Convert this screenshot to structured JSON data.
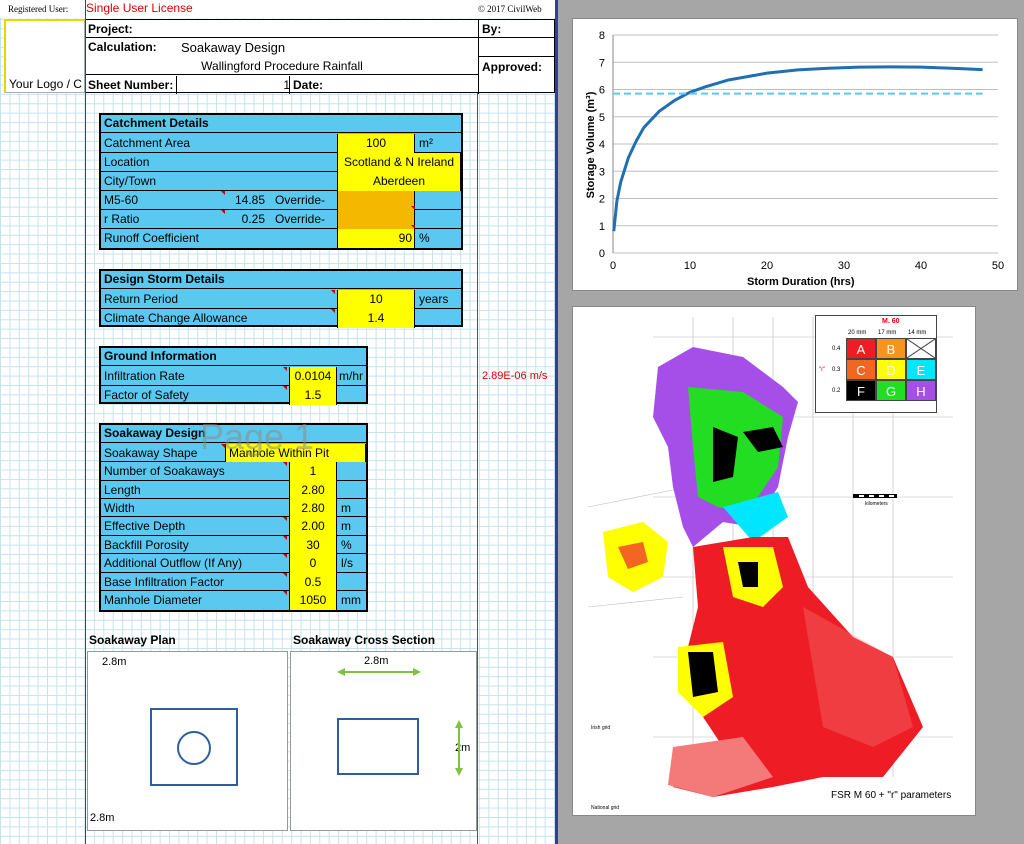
{
  "topbar": {
    "registered_label": "Registered User:",
    "license": "Single User License",
    "copyright": "© 2017 CivilWeb"
  },
  "logo": {
    "text": "Your Logo / C"
  },
  "header": {
    "project_label": "Project:",
    "by_label": "By:",
    "calculation_label": "Calculation:",
    "calculation_value": "Soakaway Design",
    "subtitle": "Wallingford Procedure Rainfall",
    "approved_label": "Approved:",
    "sheet_label": "Sheet Number:",
    "sheet_value": "1",
    "date_label": "Date:"
  },
  "watermark": "Page 1",
  "catchment": {
    "title": "Catchment Details",
    "area_label": "Catchment Area",
    "area_value": "100",
    "area_unit": "m²",
    "location_label": "Location",
    "location_value": "Scotland & N Ireland",
    "city_label": "City/Town",
    "city_value": "Aberdeen",
    "m560_label": "M5-60",
    "m560_value": "14.85",
    "override1": "Override-",
    "r_label": "r Ratio",
    "r_value": "0.25",
    "override2": "Override-",
    "runoff_label": "Runoff Coefficient",
    "runoff_value": "90",
    "runoff_unit": "%"
  },
  "storm": {
    "title": "Design Storm Details",
    "return_label": "Return Period",
    "return_value": "10",
    "return_unit": "years",
    "climate_label": "Climate Change Allowance",
    "climate_value": "1.4"
  },
  "ground": {
    "title": "Ground Information",
    "infil_label": "Infiltration Rate",
    "infil_value": "0.0104",
    "infil_unit": "m/hr",
    "infil_converted": "2.89E-06 m/s",
    "fos_label": "Factor of Safety",
    "fos_value": "1.5"
  },
  "soakaway": {
    "title": "Soakaway Design",
    "shape_label": "Soakaway Shape",
    "shape_value": "Manhole Within Pit",
    "number_label": "Number of Soakaways",
    "number_value": "1",
    "length_label": "Length",
    "length_value": "2.80",
    "width_label": "Width",
    "width_value": "2.80",
    "width_unit": "m",
    "depth_label": "Effective Depth",
    "depth_value": "2.00",
    "depth_unit": "m",
    "porosity_label": "Backfill Porosity",
    "porosity_value": "30",
    "porosity_unit": "%",
    "outflow_label": "Additional Outflow (If Any)",
    "outflow_value": "0",
    "outflow_unit": "l/s",
    "base_label": "Base Infiltration Factor",
    "base_value": "0.5",
    "manhole_label": "Manhole Diameter",
    "manhole_value": "1050",
    "manhole_unit": "mm"
  },
  "plan": {
    "title": "Soakaway Plan",
    "top_dim": "2.8m",
    "bottom_dim": "2.8m"
  },
  "section": {
    "title": "Soakaway Cross Section",
    "width_dim": "2.8m",
    "height_dim": "2m"
  },
  "chart_data": {
    "type": "line",
    "title": "",
    "xlabel": "Storm Duration (hrs)",
    "ylabel": "Storage Volume (m³)",
    "xlim": [
      0,
      50
    ],
    "ylim": [
      0,
      8
    ],
    "xticks": [
      0,
      10,
      20,
      30,
      40,
      50
    ],
    "yticks": [
      0,
      1,
      2,
      3,
      4,
      5,
      6,
      7,
      8
    ],
    "grid": true,
    "series": [
      {
        "color": "#1f6fb2",
        "style": "solid",
        "x": [
          0.1,
          0.5,
          1,
          2,
          3,
          4,
          6,
          8,
          10,
          12,
          15,
          18,
          20,
          24,
          28,
          32,
          36,
          40,
          44,
          48
        ],
        "y": [
          0.8,
          1.9,
          2.6,
          3.5,
          4.1,
          4.6,
          5.2,
          5.6,
          5.9,
          6.1,
          6.35,
          6.5,
          6.6,
          6.72,
          6.78,
          6.82,
          6.83,
          6.82,
          6.78,
          6.73
        ]
      },
      {
        "color": "#5bc8ef",
        "style": "dashed",
        "x": [
          0,
          48
        ],
        "y": [
          5.85,
          5.85
        ]
      }
    ]
  },
  "map": {
    "legend_title": "M. 60",
    "legend_cols": [
      "20 mm",
      "17 mm",
      "14 mm"
    ],
    "legend_rows": [
      "0.4",
      "0.3",
      "0.2"
    ],
    "legend_r_label": "\"r\"",
    "legend_cells": [
      "A",
      "B",
      "",
      "C",
      "D",
      "E",
      "F",
      "G",
      "H"
    ],
    "legend_colors": [
      "#ee1c24",
      "#f7941d",
      "#ffffff",
      "#f26522",
      "#ffff00",
      "#00e6ff",
      "#000000",
      "#22dd22",
      "#a64ee8"
    ],
    "scale_label": "kilometers",
    "caption": "FSR  M 60  + \"r\" parameters",
    "small_left": "Irish grid",
    "small_bottom": "National grid"
  },
  "colors": {
    "section_bg": "#5bc8ef",
    "input_yellow": "#ffff00",
    "override_orange": "#f5b800",
    "accent_red": "#e00000"
  }
}
